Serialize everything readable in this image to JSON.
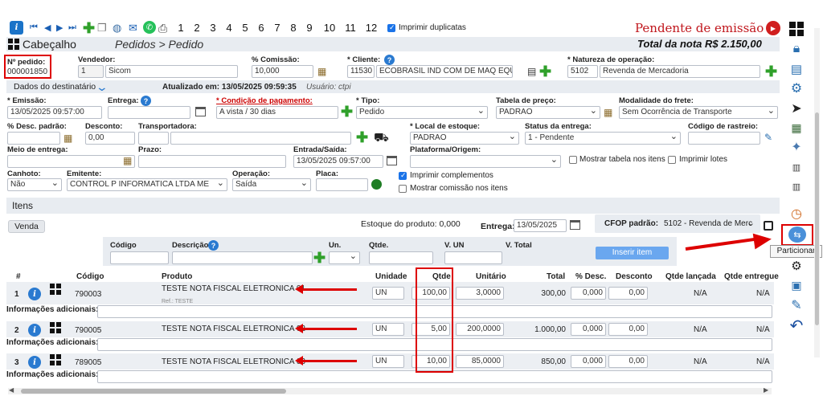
{
  "toolbar": {
    "pages": [
      "1",
      "2",
      "3",
      "4",
      "5",
      "6",
      "7",
      "8",
      "9",
      "10",
      "11",
      "12"
    ],
    "print_duplicates_label": "Imprimir duplicatas",
    "status_text": "Pendente de emissão"
  },
  "header": {
    "section_title": "Cabeçalho",
    "breadcrumb": "Pedidos > Pedido",
    "total_label": "Total da nota R$ 2.150,00"
  },
  "form": {
    "order_number_label": "Nº pedido:",
    "order_number": "000001850",
    "seller_label": "Vendedor:",
    "seller_code": "1",
    "seller_name": "Sicom",
    "commission_label": "% Comissão:",
    "commission": "10,000",
    "client_label": "* Cliente:",
    "client_code": "11530",
    "client_name": "ECOBRASIL IND COM DE MAQ EQUIP L",
    "nature_label": "* Natureza de operação:",
    "nature_code": "5102",
    "nature_name": "Revenda de Mercadoria",
    "recipient_label": "Dados do destinatário",
    "updated_label": "Atualizado em: 13/05/2025 09:59:35",
    "updated_user": "Usuário: ctpi",
    "emission_label": "* Emissão:",
    "emission": "13/05/2025 09:57:00",
    "delivery_label": "Entrega:",
    "payment_label": "* Condição de pagamento:",
    "payment": "A vista / 30 dias",
    "type_label": "* Tipo:",
    "type": "Pedido",
    "price_table_label": "Tabela de preço:",
    "price_table": "PADRAO",
    "freight_label": "Modalidade do frete:",
    "freight": "Sem Ocorrência de Transporte",
    "discount_std_label": "% Desc. padrão:",
    "discount_label": "Desconto:",
    "discount": "0,00",
    "carrier_label": "Transportadora:",
    "stock_label": "* Local de estoque:",
    "stock": "PADRAO",
    "delivery_status_label": "Status da entrega:",
    "delivery_status": "1 - Pendente",
    "tracking_label": "Código de rastreio:",
    "delivery_means_label": "Meio de entrega:",
    "term_label": "Prazo:",
    "entry_exit_label": "Entrada/Saída:",
    "entry_exit": "13/05/2025 09:57:00",
    "platform_label": "Plataforma/Origem:",
    "show_items_table": "Mostrar tabela nos itens",
    "print_batches": "Imprimir lotes",
    "stub_label": "Canhoto:",
    "stub": "Não",
    "issuer_label": "Emitente:",
    "issuer": "CONTROL P INFORMATICA LTDA ME",
    "operation_label": "Operação:",
    "operation": "Saída",
    "plate_label": "Placa:",
    "print_complements": "Imprimir complementos",
    "show_commission": "Mostrar comissão nos itens"
  },
  "items": {
    "section_title": "Itens",
    "sale_button": "Venda",
    "stock_product": "Estoque do produto: 0,000",
    "delivery_label": "Entrega:",
    "delivery_date": "13/05/2025",
    "cfop_label": "CFOP padrão:",
    "cfop_value": "5102 - Revenda de Merc",
    "entry": {
      "code": "Código",
      "description": "Descrição",
      "unit": "Un.",
      "qty": "Qtde.",
      "unit_value": "V. UN",
      "total": "V. Total",
      "insert_button": "Inserir item"
    },
    "columns": [
      "#",
      "Código",
      "Produto",
      "Unidade",
      "Qtde",
      "Unitário",
      "Total",
      "% Desc.",
      "Desconto",
      "Qtde lançada",
      "Qtde entregue"
    ],
    "additional_info_label": "Informações adicionais:",
    "rows": [
      {
        "num": "1",
        "code": "790003",
        "product": "TESTE NOTA FISCAL ELETRONICA 01",
        "ref": "Ref.: TESTE",
        "unit": "UN",
        "qty": "100,00",
        "unit_price": "3,0000",
        "total": "300,00",
        "disc_pct": "0,000",
        "disc": "0,00",
        "qty_launched": "N/A",
        "qty_delivered": "N/A"
      },
      {
        "num": "2",
        "code": "790005",
        "product": "TESTE NOTA FISCAL ELETRONICA 02",
        "ref": "",
        "unit": "UN",
        "qty": "5,00",
        "unit_price": "200,0000",
        "total": "1.000,00",
        "disc_pct": "0,000",
        "disc": "0,00",
        "qty_launched": "N/A",
        "qty_delivered": "N/A"
      },
      {
        "num": "3",
        "code": "789005",
        "product": "TESTE NOTA FISCAL ELETRONICA 03",
        "ref": "",
        "unit": "UN",
        "qty": "10,00",
        "unit_price": "85,0000",
        "total": "850,00",
        "disc_pct": "0,000",
        "disc": "0,00",
        "qty_launched": "N/A",
        "qty_delivered": "N/A"
      }
    ]
  },
  "sidebar": {
    "tooltip": "Particionar"
  },
  "colors": {
    "accent_red": "#d00000",
    "brand_blue": "#1a73c8",
    "section_bg": "#e8ecf1",
    "insert_btn": "#6aa7ef"
  }
}
